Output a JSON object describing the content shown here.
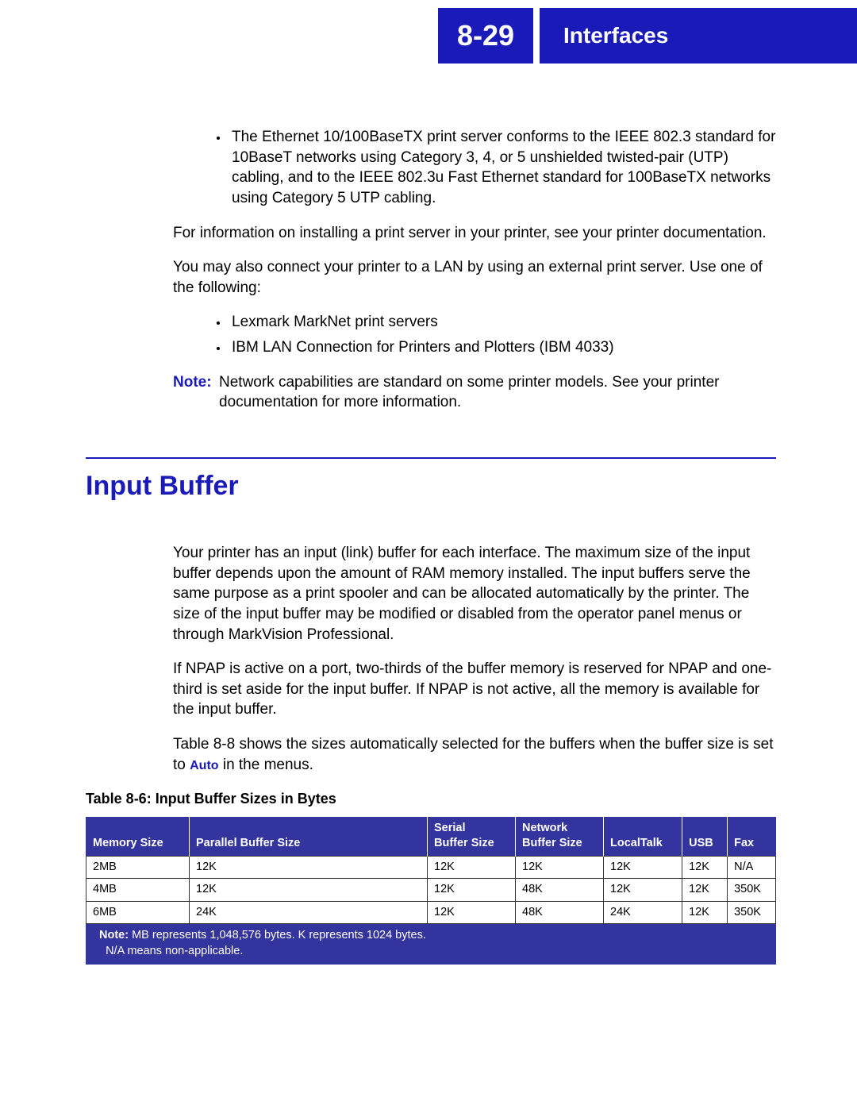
{
  "header": {
    "page_number": "8-29",
    "chapter_title": "Interfaces"
  },
  "body": {
    "bullet1": "The Ethernet 10/100BaseTX print server conforms to the IEEE 802.3 standard for 10BaseT networks using Category 3, 4, or 5 unshielded twisted-pair (UTP) cabling, and to the IEEE 802.3u Fast Ethernet standard for 100BaseTX networks using Category 5 UTP cabling.",
    "para1": "For information on installing a print server in your printer, see your printer documentation.",
    "para2": "You may also connect your printer to a LAN by using an external print server. Use one of the following:",
    "list": [
      "Lexmark MarkNet print servers",
      "IBM LAN Connection for Printers and Plotters (IBM 4033)"
    ],
    "note_label": "Note:",
    "note_text": "Network capabilities are standard on some printer models. See your printer documentation for more information.",
    "section_heading": "Input Buffer",
    "para3": "Your printer has an input (link) buffer for each interface. The maximum size of the input buffer depends upon the amount of RAM memory installed. The input buffers serve the same purpose as a print spooler and can be allocated automatically by the printer. The size of the input buffer may be modified or disabled from the operator panel menus or through MarkVision Professional.",
    "para4": "If NPAP is active on a port, two-thirds of the buffer memory is reserved for NPAP and one-third is set aside for the input buffer. If NPAP is not active, all the memory is available for the input buffer.",
    "para5_a": "Table 8-8 shows the sizes automatically selected for the buffers when the buffer size is set to ",
    "para5_auto": "Auto",
    "para5_b": " in the menus.",
    "table_caption": "Table 8-6:  Input Buffer Sizes in Bytes"
  },
  "table": {
    "headers": {
      "c0": "Memory Size",
      "c1": "Parallel Buffer Size",
      "c2": "Serial\nBuffer Size",
      "c3": "Network\nBuffer Size",
      "c4": "LocalTalk",
      "c5": "USB",
      "c6": "Fax"
    },
    "rows": [
      {
        "c0": "2MB",
        "c1": "12K",
        "c2": "12K",
        "c3": "12K",
        "c4": "12K",
        "c5": "12K",
        "c6": "N/A"
      },
      {
        "c0": "4MB",
        "c1": "12K",
        "c2": "12K",
        "c3": "48K",
        "c4": "12K",
        "c5": "12K",
        "c6": "350K"
      },
      {
        "c0": "6MB",
        "c1": "24K",
        "c2": "12K",
        "c3": "48K",
        "c4": "24K",
        "c5": "12K",
        "c6": "350K"
      }
    ],
    "footnote_bold": "Note:",
    "footnote_line1": " MB represents 1,048,576 bytes. K represents 1024 bytes.",
    "footnote_line2": "N/A means non-applicable."
  }
}
